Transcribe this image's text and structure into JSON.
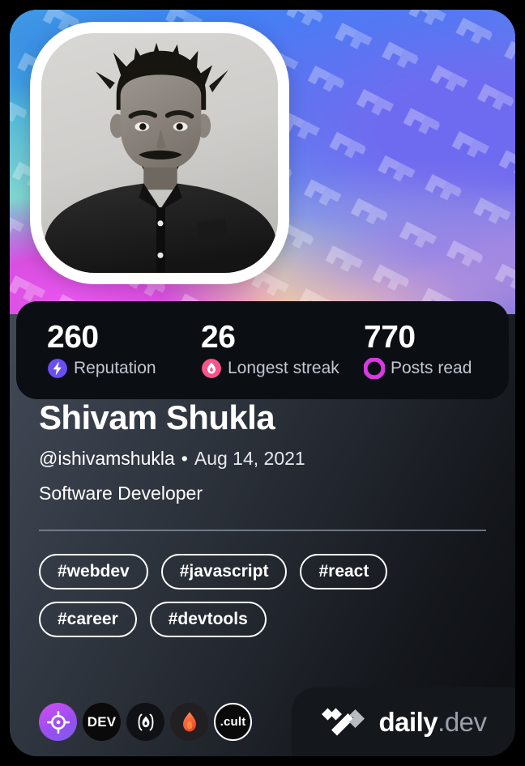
{
  "card": {
    "type": "daily.dev developer profile card"
  },
  "cover": {
    "watermark_icon": "daily-dev-logo-pattern",
    "gradient_colors": [
      "#39a0d8",
      "#4b8ef0",
      "#9ad7d2",
      "#f0b5c8",
      "#e855ef",
      "#7b5cf0"
    ]
  },
  "avatar": {
    "alt": "Profile photo of Shivam Shukla",
    "border_color": "#ffffff"
  },
  "stats": [
    {
      "value": "260",
      "label": "Reputation",
      "icon": "reputation-bolt-icon",
      "color": "#6b4ef0"
    },
    {
      "value": "26",
      "label": "Longest streak",
      "icon": "streak-flame-icon",
      "color": "#f8558b"
    },
    {
      "value": "770",
      "label": "Posts read",
      "icon": "posts-read-ring-icon",
      "color": "#d63ae0"
    }
  ],
  "profile": {
    "name": "Shivam Shukla",
    "handle": "@ishivamshukla",
    "separator": "•",
    "joined": "Aug 14, 2021",
    "role": "Software Developer"
  },
  "tags": [
    {
      "label": "#webdev"
    },
    {
      "label": "#javascript"
    },
    {
      "label": "#react"
    },
    {
      "label": "#career"
    },
    {
      "label": "#devtools"
    }
  ],
  "badges": [
    {
      "name": "target-badge",
      "icon": "crosshair-target-icon",
      "text": ""
    },
    {
      "name": "dev-badge",
      "icon": "dev-wordmark-icon",
      "text": "DEV"
    },
    {
      "name": "paren-flame-badge",
      "icon": "parenthesis-flame-icon",
      "text": ""
    },
    {
      "name": "flame-badge",
      "icon": "orange-flame-icon",
      "text": ""
    },
    {
      "name": "cult-badge",
      "icon": "cult-wordmark-icon",
      "text": ".cult"
    }
  ],
  "brand": {
    "logo_icon": "daily-dev-logo-icon",
    "name": "daily",
    "suffix": ".dev"
  }
}
